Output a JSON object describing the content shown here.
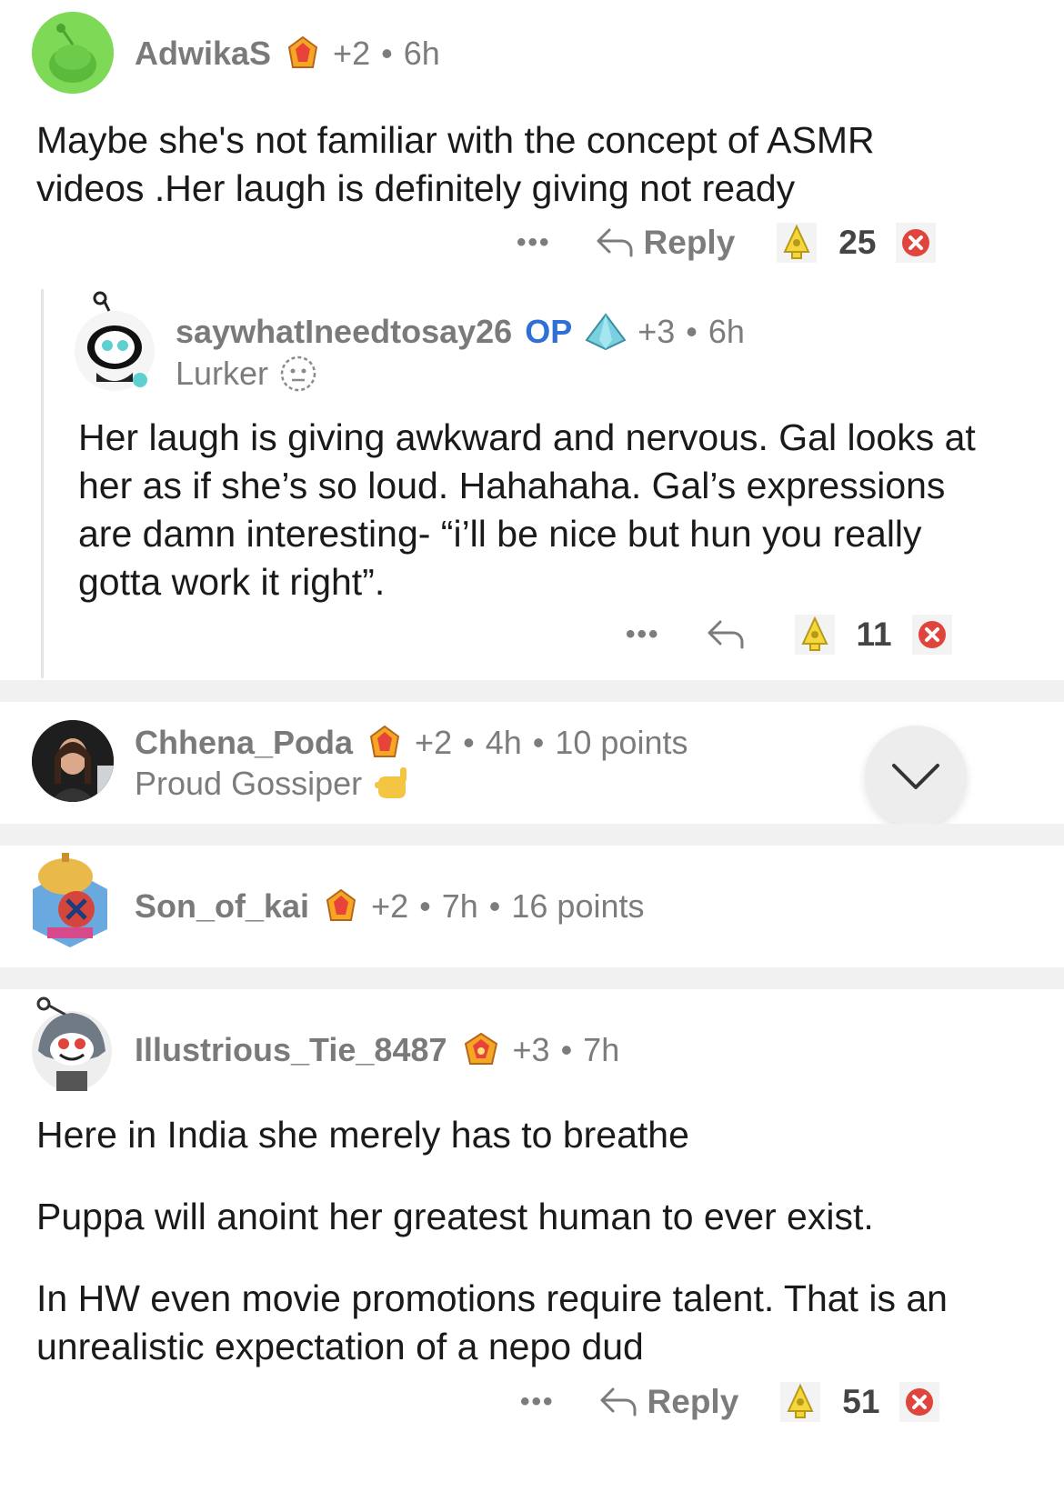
{
  "comments": [
    {
      "username": "AdwikaS",
      "award_extra": "+2",
      "age": "6h",
      "body": [
        "Maybe she's not familiar with the concept of ASMR videos .Her laugh is definitely giving not ready"
      ],
      "actions": {
        "more": "•••",
        "reply": "Reply",
        "score": "25"
      }
    },
    {
      "username": "saywhatIneedtosay26",
      "op_label": "OP",
      "award_extra": "+3",
      "age": "6h",
      "flair": "Lurker",
      "body": [
        "Her laugh is giving awkward and nervous. Gal looks at her as if she’s so loud. Hahahaha. Gal’s expressions are damn interesting- “i’ll be nice but hun you really gotta work it right”."
      ],
      "actions": {
        "more": "•••",
        "score": "11"
      }
    },
    {
      "username": "Chhena_Poda",
      "award_extra": "+2",
      "age": "4h",
      "points": "10 points",
      "flair": "Proud Gossiper",
      "collapsed": true
    },
    {
      "username": "Son_of_kai",
      "award_extra": "+2",
      "age": "7h",
      "points": "16 points",
      "collapsed": true
    },
    {
      "username": "Illustrious_Tie_8487",
      "award_extra": "+3",
      "age": "7h",
      "body": [
        "Here in India she merely has to breathe",
        "Puppa will anoint her greatest human to ever exist.",
        "In HW even movie promotions require talent. That is an unrealistic expectation of a nepo dud"
      ],
      "actions": {
        "more": "•••",
        "reply": "Reply",
        "score": "51"
      }
    }
  ],
  "separator_dot": "•",
  "colors": {
    "op": "#2f6fd6",
    "meta": "#7c7c7c",
    "downvote": "#e0453d",
    "separator": "#f1f1f2"
  },
  "icons": [
    "crystal-award-icon",
    "diamond-award-icon",
    "reply-arrow-icon",
    "upvote-award-icon",
    "downvote-icon",
    "neutral-face-icon",
    "call-me-hand-icon",
    "chevron-down-icon"
  ]
}
